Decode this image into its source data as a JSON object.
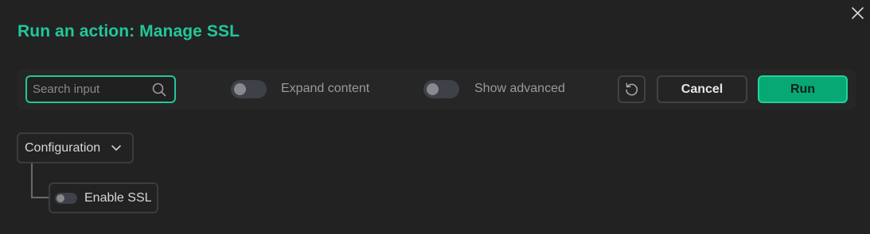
{
  "dialog": {
    "title": "Run an action: Manage SSL",
    "close_icon": "close-icon"
  },
  "toolbar": {
    "search": {
      "placeholder": "Search input",
      "value": "",
      "icon": "search-icon"
    },
    "expand_content": {
      "label": "Expand content",
      "on": false
    },
    "show_advanced": {
      "label": "Show advanced",
      "on": false
    },
    "reset_icon": "reset-icon",
    "cancel_label": "Cancel",
    "run_label": "Run"
  },
  "config": {
    "group_label": "Configuration",
    "group_icon": "chevron-down-icon",
    "items": [
      {
        "label": "Enable SSL",
        "on": false
      }
    ]
  },
  "colors": {
    "accent": "#22c79a",
    "run_button": "#07a874",
    "background": "#222222"
  }
}
